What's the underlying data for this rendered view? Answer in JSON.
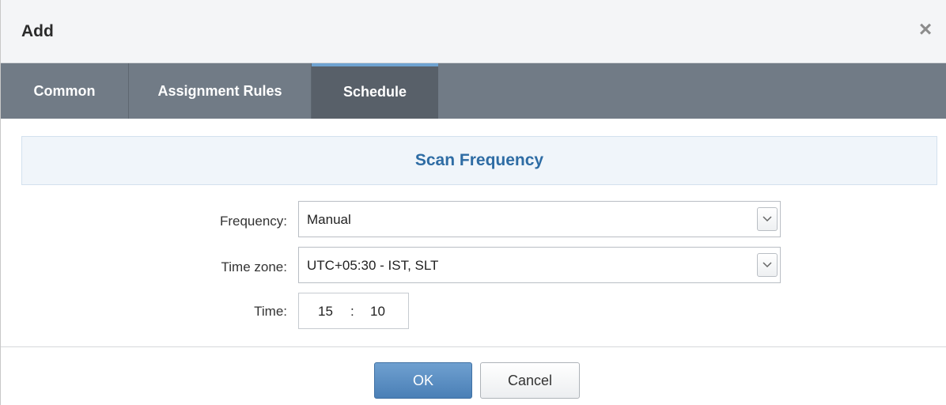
{
  "dialog": {
    "title": "Add"
  },
  "tabs": [
    {
      "label": "Common",
      "active": false
    },
    {
      "label": "Assignment Rules",
      "active": false
    },
    {
      "label": "Schedule",
      "active": true
    }
  ],
  "section": {
    "title": "Scan Frequency"
  },
  "form": {
    "frequency": {
      "label": "Frequency:",
      "value": "Manual"
    },
    "timezone": {
      "label": "Time zone:",
      "value": "UTC+05:30 - IST, SLT"
    },
    "time": {
      "label": "Time:",
      "hours": "15",
      "separator": ":",
      "minutes": "10"
    }
  },
  "buttons": {
    "ok": "OK",
    "cancel": "Cancel"
  },
  "colors": {
    "tab_bar": "#717b86",
    "active_tab": "#586069",
    "active_tab_indicator": "#6fa3d1",
    "section_title": "#2e6ca4",
    "ok_button": "#4a7fb6"
  },
  "icons": {
    "close": "close-icon",
    "dropdown": "chevron-down-icon"
  }
}
